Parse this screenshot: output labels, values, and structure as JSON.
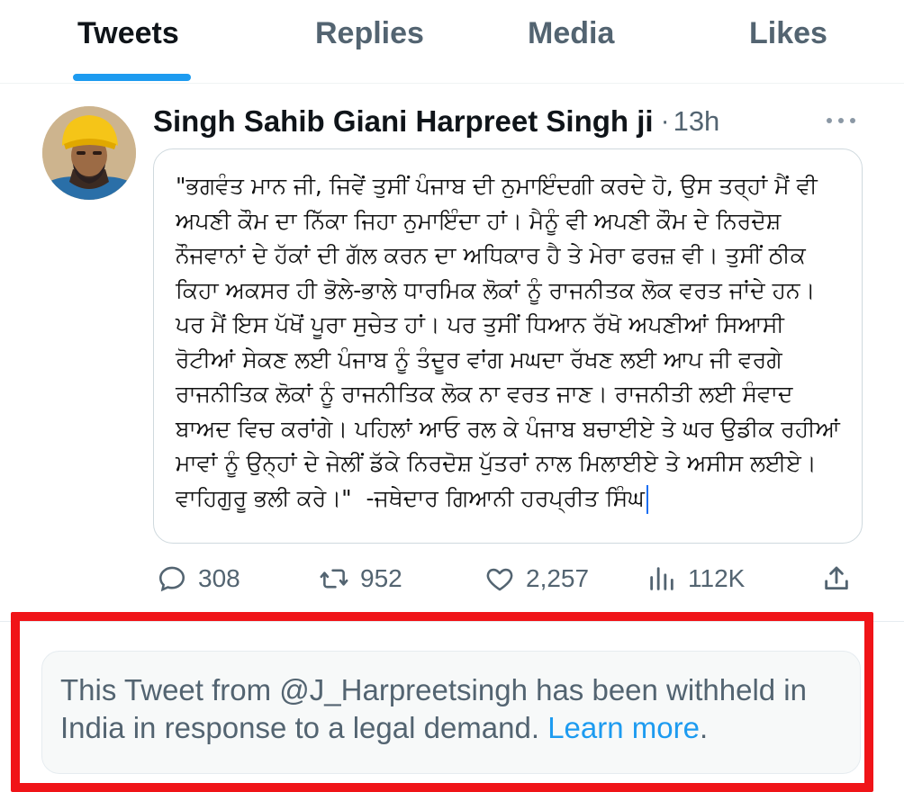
{
  "tabs": [
    {
      "label": "Tweets",
      "active": true
    },
    {
      "label": "Replies",
      "active": false
    },
    {
      "label": "Media",
      "active": false
    },
    {
      "label": "Likes",
      "active": false
    }
  ],
  "tweet": {
    "author": "Singh Sahib Giani Harpreet Singh ji",
    "separator": "·",
    "time": "13h",
    "avatar_icon": "profile-photo",
    "more_icon": "ellipsis-icon",
    "image_text": "\"ਭਗਵੰਤ ਮਾਨ ਜੀ, ਜਿਵੇਂ ਤੁਸੀਂ ਪੰਜਾਬ ਦੀ ਨੁਮਾਇੰਦਗੀ ਕਰਦੇ ਹੋ, ਉਸ ਤਰ੍ਹਾਂ ਮੈਂ ਵੀ ਅਪਣੀ ਕੌਮ ਦਾ ਨਿੱਕਾ ਜਿਹਾ ਨੁਮਾਇੰਦਾ ਹਾਂ। ਮੈਨੂੰ ਵੀ ਅਪਣੀ ਕੌਮ ਦੇ ਨਿਰਦੋਸ਼ ਨੌਜਵਾਨਾਂ ਦੇ ਹੱਕਾਂ ਦੀ ਗੱਲ ਕਰਨ ਦਾ ਅਧਿਕਾਰ ਹੈ ਤੇ ਮੇਰਾ ਫਰਜ਼ ਵੀ। ਤੁਸੀਂ ਠੀਕ ਕਿਹਾ ਅਕਸਰ ਹੀ ਭੋਲੇ-ਭਾਲੇ ਧਾਰਮਿਕ ਲੋਕਾਂ ਨੂੰ ਰਾਜਨੀਤਕ ਲੋਕ ਵਰਤ ਜਾਂਦੇ ਹਨ। ਪਰ ਮੈਂ ਇਸ ਪੱਖੋਂ ਪੂਰਾ ਸੁਚੇਤ ਹਾਂ। ਪਰ ਤੁਸੀਂ ਧਿਆਨ ਰੱਖੋ ਅਪਣੀਆਂ ਸਿਆਸੀ ਰੋਟੀਆਂ ਸੇਕਣ ਲਈ ਪੰਜਾਬ ਨੂੰ ਤੰਦੂਰ ਵਾਂਗ ਮਘਦਾ ਰੱਖਣ ਲਈ ਆਪ ਜੀ ਵਰਗੇ ਰਾਜਨੀਤਿਕ ਲੋਕਾਂ ਨੂੰ ਰਾਜਨੀਤਿਕ ਲੋਕ ਨਾ ਵਰਤ ਜਾਣ। ਰਾਜਨੀਤੀ ਲਈ ਸੰਵਾਦ ਬਾਅਦ ਵਿਚ ਕਰਾਂਗੇ। ਪਹਿਲਾਂ ਆਓ ਰਲ ਕੇ ਪੰਜਾਬ ਬਚਾਈਏ ਤੇ ਘਰ ਉਡੀਕ ਰਹੀਆਂ ਮਾਵਾਂ ਨੂੰ ਉਨ੍ਹਾਂ ਦੇ ਜੇਲੀਂ ਡੱਕੇ ਨਿਰਦੋਸ਼ ਪੁੱਤਰਾਂ ਨਾਲ ਮਿਲਾਈਏ ਤੇ ਅਸੀਸ ਲਈਏ।ਵਾਹਿਗੁਰੂ ਭਲੀ ਕਰੇ।\"  -ਜਥੇਦਾਰ ਗਿਆਨੀ ਹਰਪ੍ਰੀਤ ਸਿੰਘ"
  },
  "actions": {
    "replies": {
      "icon": "reply-icon",
      "count": "308"
    },
    "retweets": {
      "icon": "retweet-icon",
      "count": "952"
    },
    "likes": {
      "icon": "heart-icon",
      "count": "2,257"
    },
    "views": {
      "icon": "views-icon",
      "count": "112K"
    },
    "share": {
      "icon": "share-icon"
    }
  },
  "withheld_notice": {
    "text": "This Tweet from @J_Harpreetsingh has been withheld in India in response to a legal demand. ",
    "link_text": "Learn more",
    "end": "."
  },
  "colors": {
    "accent": "#1d9bf0",
    "muted": "#536471",
    "highlight_border": "#f01418"
  }
}
